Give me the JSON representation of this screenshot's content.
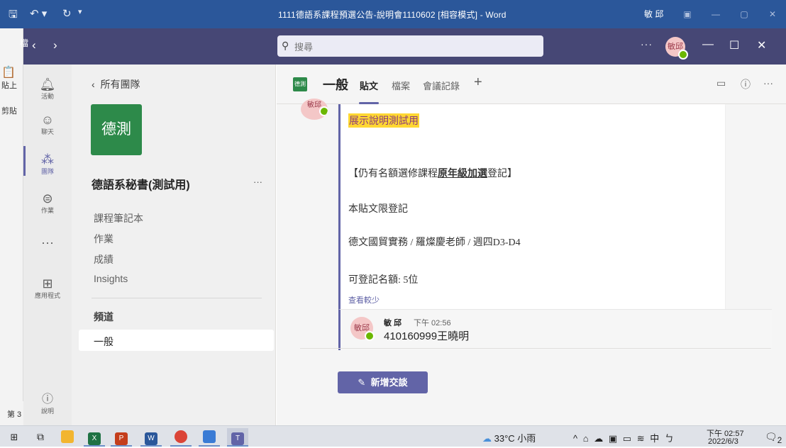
{
  "word": {
    "title": "1111德語系課程預選公告-說明會1110602 [相容模式] - Word",
    "user": "敏 邱",
    "ribbon_tab": "檔",
    "paste_label": "貼上",
    "clipboard_label": "剪貼",
    "status_page": "第 3"
  },
  "topbar": {
    "search_placeholder": "搜尋",
    "more": "···",
    "avatar_initials": "敏邱"
  },
  "rail": {
    "items": [
      {
        "label": "活動",
        "icon": "bell-icon"
      },
      {
        "label": "聊天",
        "icon": "chat-icon"
      },
      {
        "label": "團隊",
        "icon": "teams-icon"
      },
      {
        "label": "作業",
        "icon": "assignments-icon"
      },
      {
        "label": "···",
        "icon": "more-icon"
      },
      {
        "label": "應用程式",
        "icon": "apps-icon"
      }
    ],
    "help": "說明"
  },
  "team": {
    "back_label": "所有團隊",
    "tile_text": "德測",
    "name": "德語系秘書(測試用)",
    "more": "···",
    "links": [
      "課程筆記本",
      "作業",
      "成績",
      "Insights"
    ],
    "channels_title": "頻道",
    "channel": "一般"
  },
  "channel": {
    "tile_text": "德測",
    "title": "一般",
    "tabs": [
      "貼文",
      "檔案",
      "會議記錄"
    ]
  },
  "post": {
    "avatar_initials": "敏邱",
    "highlight": "展示說明測試用",
    "headline_prefix": "【仍有名額選修課程",
    "headline_bold": "原年級加選",
    "headline_suffix": "登記】",
    "line1": "本貼文限登記",
    "line2": "德文國貿實務 / 羅燦慶老師 / 週四D3-D4",
    "line3": "可登記名額: 5位",
    "see_less": "查看較少"
  },
  "reply": {
    "avatar_initials": "敏邱",
    "author": "敏 邱",
    "time": "下午 02:56",
    "text": "410160999王曉明"
  },
  "new_conversation": "新增交談",
  "taskbar": {
    "weather": "33°C 小雨",
    "ime": "中",
    "time": "下午 02:57",
    "date": "2022/6/3",
    "notifications": "2"
  }
}
